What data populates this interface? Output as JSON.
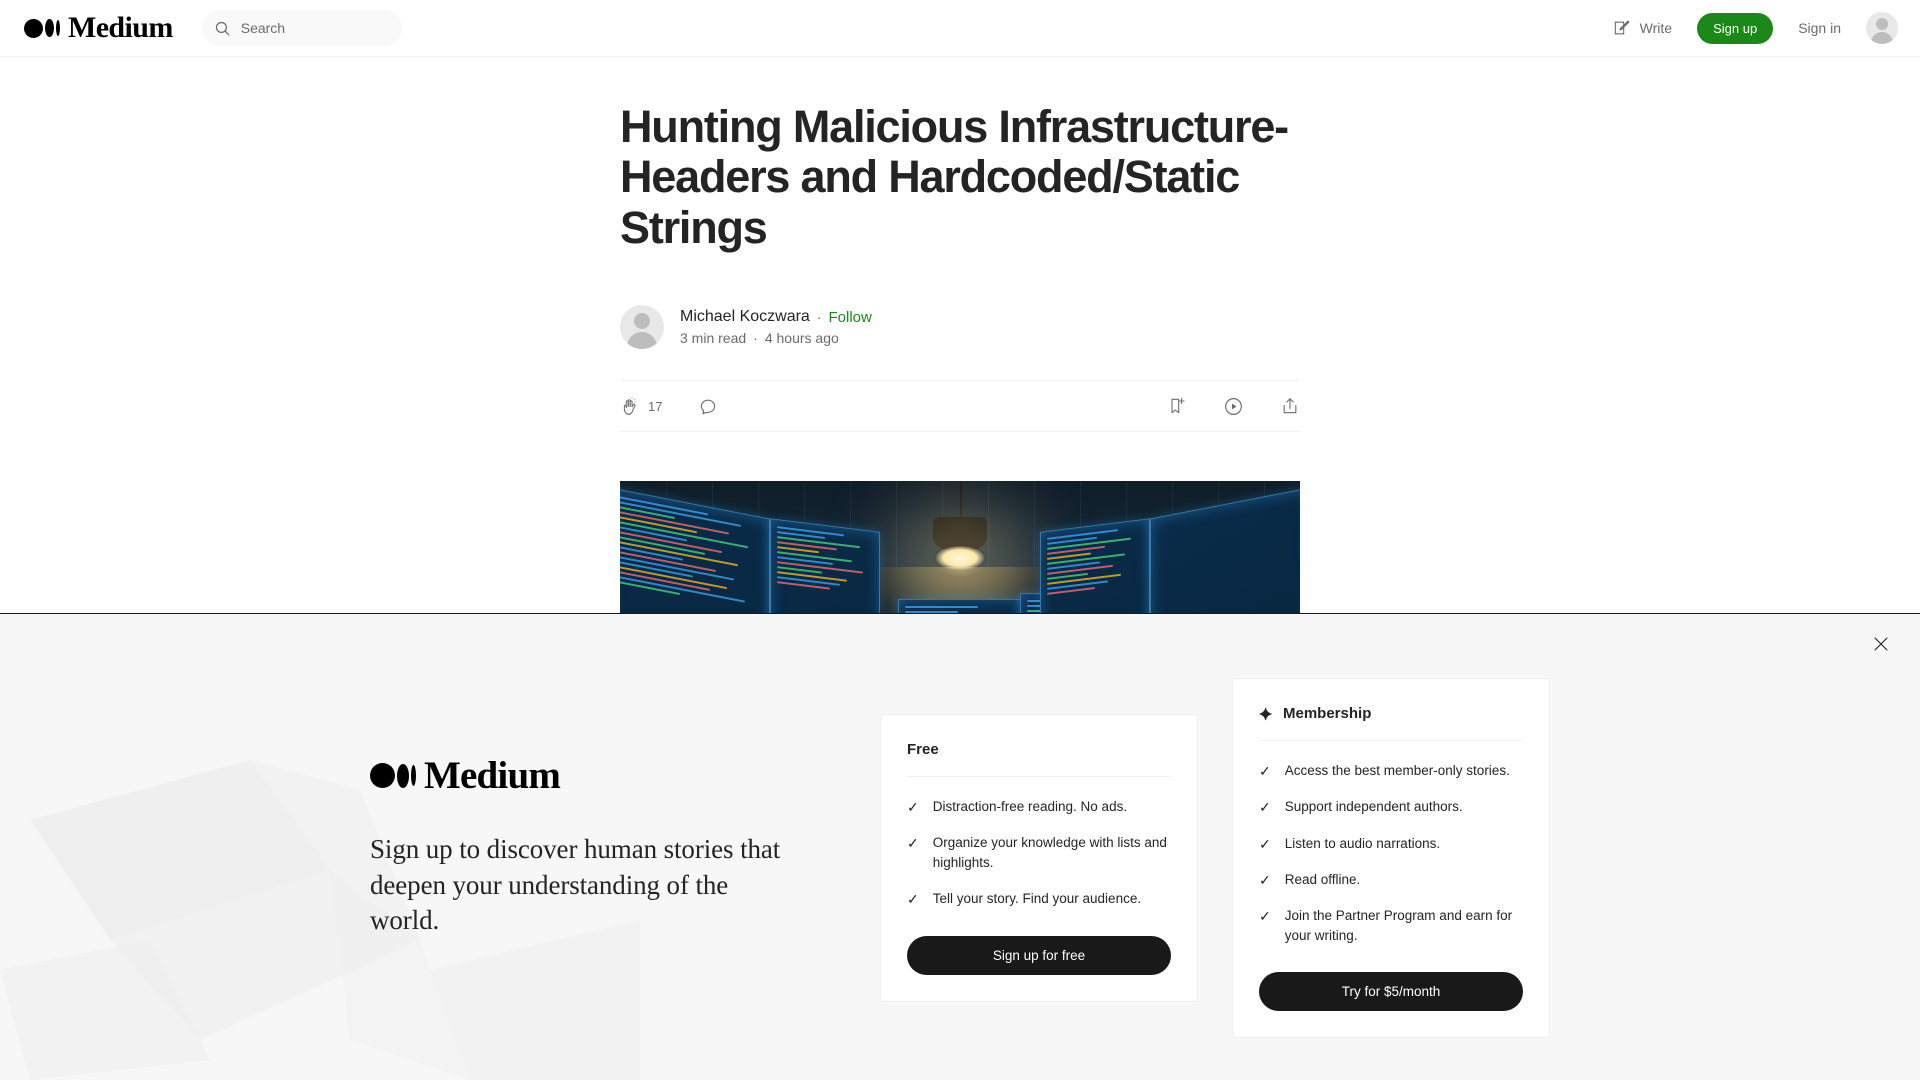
{
  "nav": {
    "brand": "Medium",
    "search": {
      "placeholder": "Search",
      "value": "",
      "icon": "search-icon"
    },
    "write_label": "Write",
    "write_icon": "write-pencil-icon",
    "signup_label": "Sign up",
    "signin_label": "Sign in",
    "avatar_icon": "user-avatar-icon",
    "signup_color": "#1a8917"
  },
  "article": {
    "title": "Hunting Malicious Infrastructure-Headers and Hardcoded/Static Strings",
    "author": "Michael Koczwara",
    "follow_label": "Follow",
    "separator": "·",
    "read_time": "3 min read",
    "published": "4 hours ago",
    "engagement": {
      "clap_icon": "clap-icon",
      "clap_count": "17",
      "comment_icon": "comment-icon",
      "bookmark_icon": "bookmark-add-icon",
      "listen_icon": "listen-play-icon",
      "share_icon": "share-icon"
    },
    "hero_alt": "Cyber security operations room with monitors, hanging lamp and glowing spider"
  },
  "banner": {
    "close_icon": "close-icon",
    "brand": "Medium",
    "headline": "Sign up to discover human stories that deepen your understanding of the world.",
    "free": {
      "title": "Free",
      "benefits": [
        "Distraction-free reading. No ads.",
        "Organize your knowledge with lists and highlights.",
        "Tell your story. Find your audience."
      ],
      "cta": "Sign up for free"
    },
    "membership": {
      "icon": "sparkle-icon",
      "title": "Membership",
      "benefits": [
        "Access the best member-only stories.",
        "Support independent authors.",
        "Listen to audio narrations.",
        "Read offline.",
        "Join the Partner Program and earn for your writing."
      ],
      "cta": "Try for $5/month"
    },
    "check_glyph": "✓"
  }
}
